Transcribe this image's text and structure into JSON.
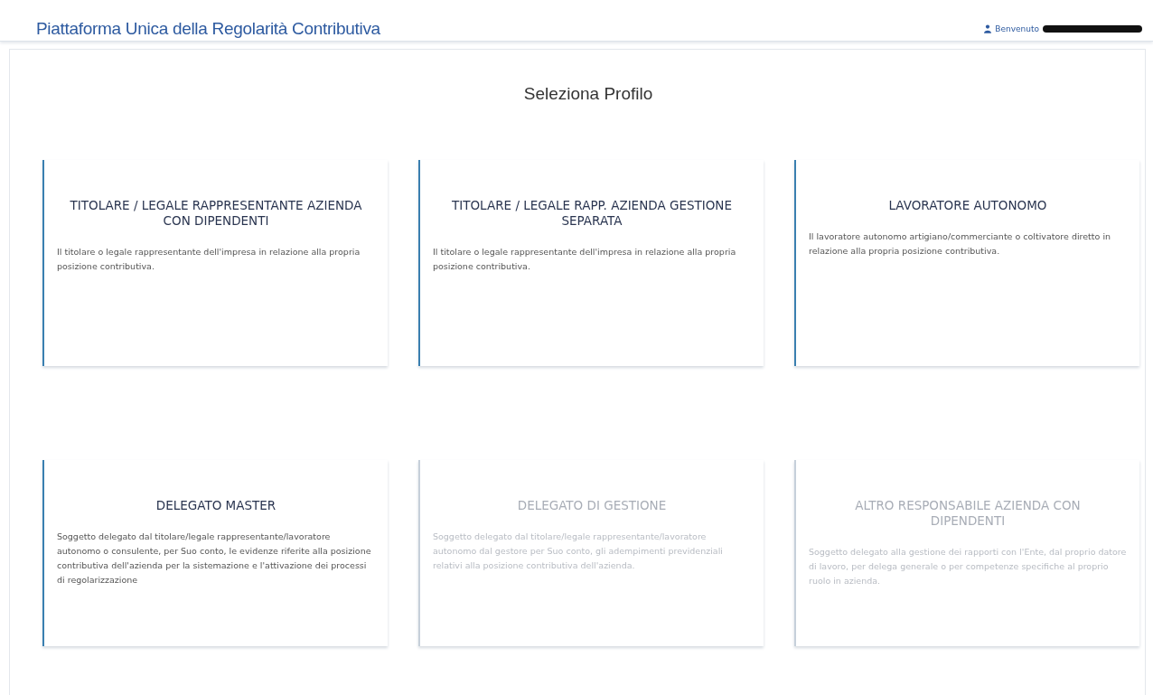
{
  "header": {
    "title": "Piattaforma Unica della Regolarità Contributiva",
    "user_label": "Benvenuto",
    "user_name_redacted": true
  },
  "page_title": "Seleziona Profilo",
  "profiles": [
    {
      "title": "TITOLARE / LEGALE RAPPRESENTANTE AZIENDA CON DIPENDENTI",
      "description": "Il titolare o legale rappresentante dell'impresa in relazione alla propria posizione contributiva.",
      "disabled": false
    },
    {
      "title": "TITOLARE / LEGALE RAPP. AZIENDA GESTIONE SEPARATA",
      "description": "Il titolare o legale rappresentante dell'impresa in relazione alla propria posizione contributiva.",
      "disabled": false
    },
    {
      "title": "LAVORATORE AUTONOMO",
      "description": "Il lavoratore autonomo artigiano/commerciante o coltivatore diretto in relazione alla propria posizione contributiva.",
      "disabled": false
    },
    {
      "title": "DELEGATO MASTER",
      "description": "Soggetto delegato dal titolare/legale rappresentante/lavoratore autonomo o consulente, per Suo conto, le evidenze riferite alla posizione contributiva dell'azienda per la sistemazione e l'attivazione dei processi di regolarizzazione",
      "disabled": false
    },
    {
      "title": "DELEGATO DI GESTIONE",
      "description": "Soggetto delegato dal titolare/legale rappresentante/lavoratore autonomo dal gestore per Suo conto, gli adempimenti previdenziali relativi alla posizione contributiva dell'azienda.",
      "disabled": true
    },
    {
      "title": "ALTRO RESPONSABILE AZIENDA CON DIPENDENTI",
      "description": "Soggetto delegato alla gestione dei rapporti con l'Ente, dal proprio datore di lavoro, per delega generale o per competenze specifiche al proprio ruolo in azienda.",
      "disabled": true
    }
  ]
}
